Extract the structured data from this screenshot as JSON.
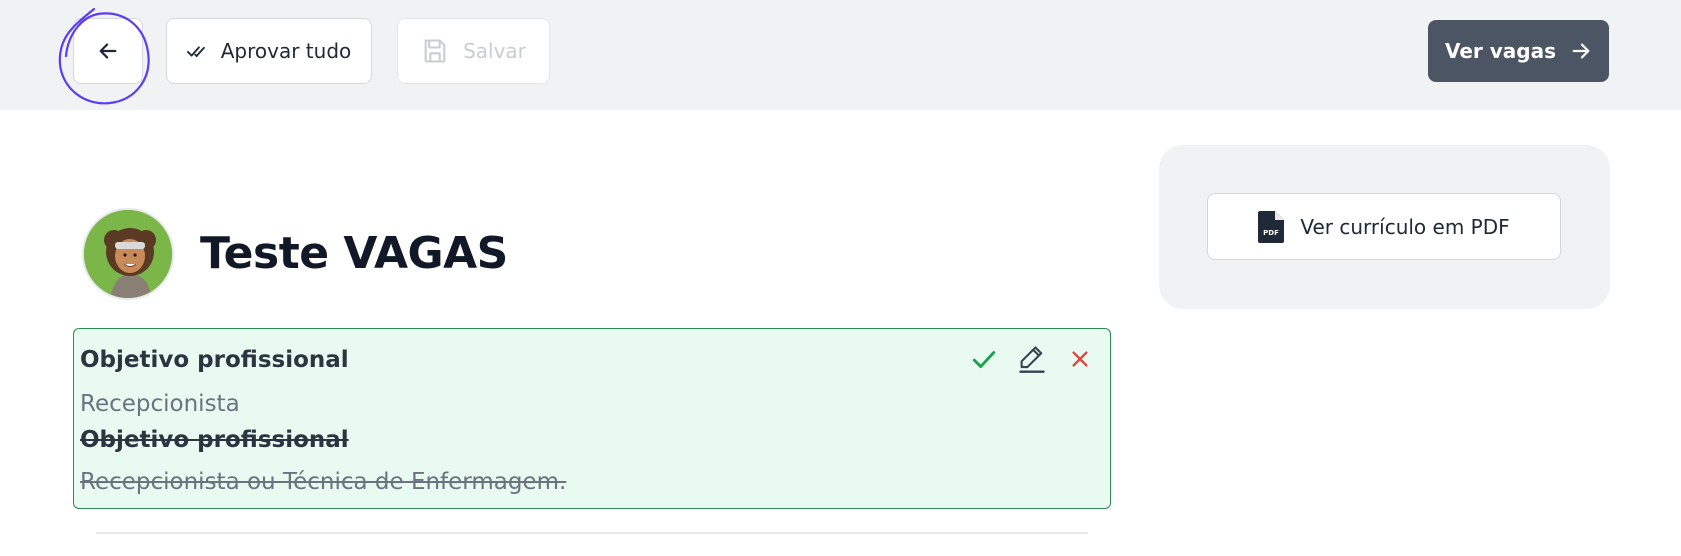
{
  "toolbar": {
    "approve_label": "Aprovar tudo",
    "save_label": "Salvar",
    "vagas_label": "Ver vagas"
  },
  "sidebar": {
    "pdf_label": "Ver currículo em PDF",
    "pdf_icon_text": "PDF"
  },
  "profile": {
    "name": "Teste VAGAS"
  },
  "change_card": {
    "new_heading": "Objetivo profissional",
    "new_value": "Recepcionista",
    "old_heading": "Objetivo profissional",
    "old_value": "Recepcionista ou Técnica de Enfermagem."
  },
  "colors": {
    "accent_dark": "#4b5563",
    "approve_green": "#16a34a",
    "reject_red": "#e0443a",
    "card_bg": "#e9fbf0",
    "card_border": "#2e8b57",
    "annotation": "#5b3df5"
  }
}
